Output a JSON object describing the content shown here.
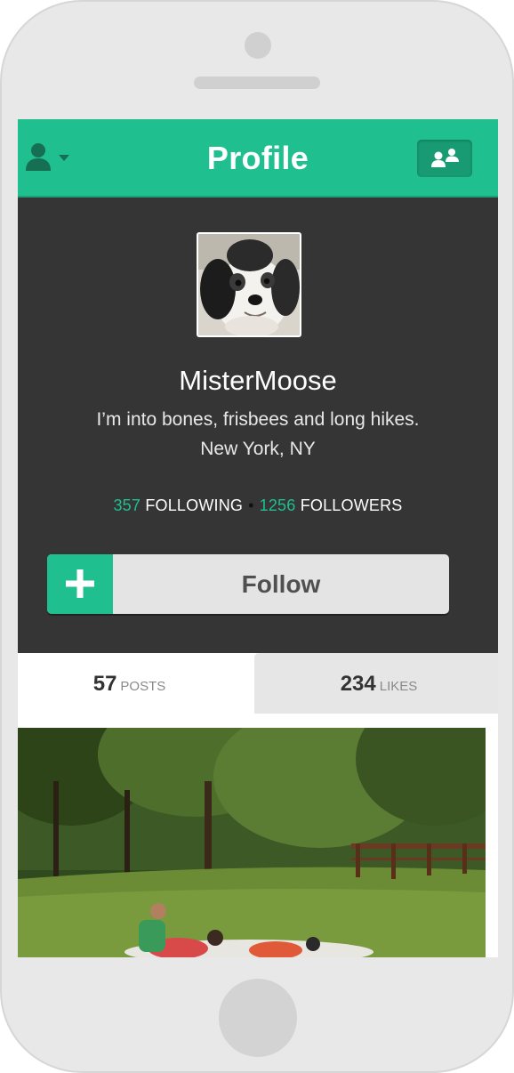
{
  "navbar": {
    "title": "Profile",
    "left_icon": "user-dropdown-icon",
    "right_icon": "people-icon",
    "accent_color": "#1fbf8f"
  },
  "profile": {
    "username": "MisterMoose",
    "bio": "I’m into bones, frisbees and long hikes.",
    "location": "New York, NY",
    "following_count": "357",
    "following_label": "FOLLOWING",
    "followers_count": "1256",
    "followers_label": "FOLLOWERS",
    "separator": "•",
    "avatar_icon": "dog-avatar"
  },
  "follow_button": {
    "label": "Follow",
    "icon": "plus-icon"
  },
  "tabs": [
    {
      "count": "57",
      "label": "POSTS",
      "active": true
    },
    {
      "count": "234",
      "label": "LIKES",
      "active": false
    }
  ],
  "feed": {
    "photo": "outdoor-lawn-photo"
  },
  "colors": {
    "header_bg": "#1fbf8f",
    "profile_bg": "#353535",
    "follow_bg": "#e4e4e4"
  }
}
